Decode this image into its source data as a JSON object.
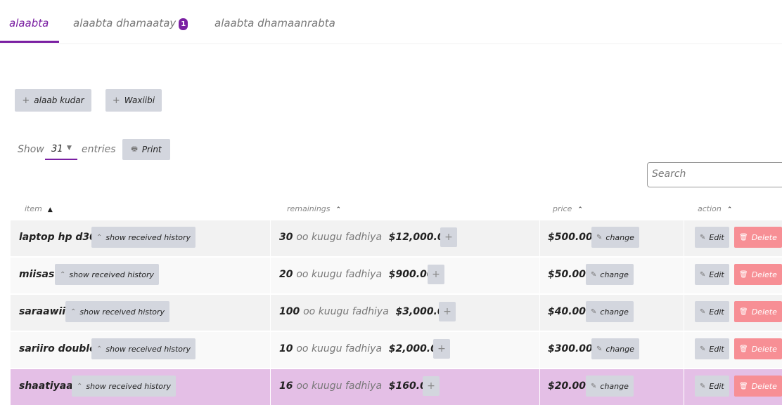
{
  "tabs": [
    {
      "label": "alaabta"
    },
    {
      "label": "alaabta dhamaatay",
      "badge": "1"
    },
    {
      "label": "alaabta dhamaanrabta"
    }
  ],
  "toolbar": {
    "add_item": "alaab kudar",
    "report": "Waxiibi"
  },
  "list_controls": {
    "show": "Show",
    "entries_value": "31",
    "entries": "entries",
    "print": "Print",
    "search_placeholder": "Search"
  },
  "table": {
    "headers": {
      "item": "item",
      "remainings": "remainings",
      "price": "price",
      "action": "action"
    },
    "history_label": "show received history",
    "change_label": "change",
    "edit_label": "Edit",
    "delete_label": "Delete",
    "rows": [
      {
        "item": "laptop hp d30",
        "qty": "30",
        "qty_text": "oo kuugu fadhiya",
        "total": "$12,000.00",
        "price": "$500.00"
      },
      {
        "item": "miisas",
        "qty": "20",
        "qty_text": "oo kuugu fadhiya",
        "total": "$900.00",
        "price": "$50.00"
      },
      {
        "item": "saraawiil",
        "qty": "100",
        "qty_text": "oo kuugu fadhiya",
        "total": "$3,000.00",
        "price": "$40.00"
      },
      {
        "item": "sariiro double",
        "qty": "10",
        "qty_text": "oo kuugu fadhiya",
        "total": "$2,000.00",
        "price": "$300.00"
      },
      {
        "item": "shaatiyaal",
        "qty": "16",
        "qty_text": "oo kuugu fadhiya",
        "total": "$160.00",
        "price": "$20.00"
      }
    ]
  },
  "colors": {
    "accent": "#7a1fa2",
    "button": "#d3d6de",
    "delete": "#f78f95",
    "highlight_row": "#e4bfe6"
  }
}
